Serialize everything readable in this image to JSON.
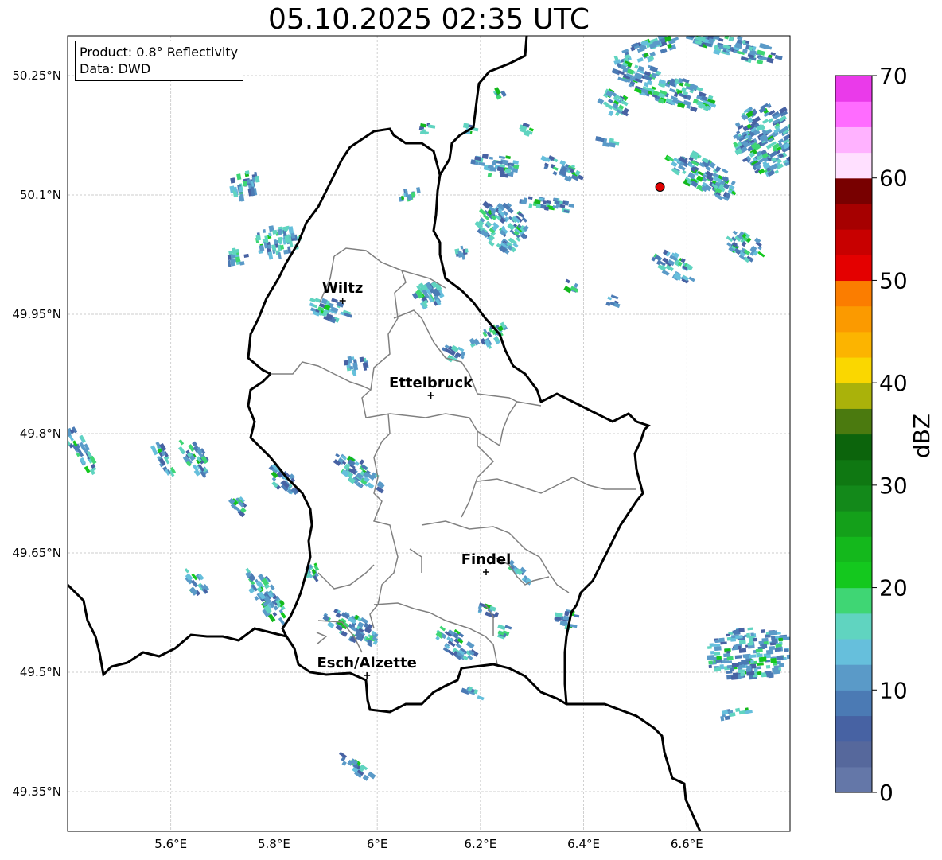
{
  "title": "05.10.2025 02:35 UTC",
  "info_box": {
    "product": "Product: 0.8° Reflectivity",
    "data": "Data: DWD"
  },
  "axes": {
    "lon_range": [
      5.4,
      6.8
    ],
    "lat_range": [
      49.3,
      50.3
    ],
    "x_ticks": [
      "5.6°E",
      "5.8°E",
      "6°E",
      "6.2°E",
      "6.4°E",
      "6.6°E"
    ],
    "y_ticks": [
      "50.25°N",
      "50.1°N",
      "49.95°N",
      "49.8°N",
      "49.65°N",
      "49.5°N",
      "49.35°N"
    ],
    "grid": true
  },
  "cities": [
    {
      "name": "Wiltz",
      "lon": 5.933,
      "lat": 49.967
    },
    {
      "name": "Ettelbruck",
      "lon": 6.104,
      "lat": 49.848
    },
    {
      "name": "Findel",
      "lon": 6.211,
      "lat": 49.626
    },
    {
      "name": "Esch/Alzette",
      "lon": 5.98,
      "lat": 49.496
    }
  ],
  "radar_site": {
    "lon": 6.548,
    "lat": 50.11,
    "color": "#e00000"
  },
  "colorbar": {
    "label": "dBZ",
    "min": 0,
    "max": 70,
    "step": 2.5,
    "ticks": [
      "0",
      "10",
      "20",
      "30",
      "40",
      "50",
      "60",
      "70"
    ],
    "colors": [
      "#6477a8",
      "#56689c",
      "#4762a3",
      "#4b7ab4",
      "#5a9ac8",
      "#66bfdc",
      "#60d4c0",
      "#3fd674",
      "#14c81e",
      "#14b81c",
      "#14a01a",
      "#13891a",
      "#0f7812",
      "#0c640c",
      "#4b7a0f",
      "#aab20a",
      "#fad700",
      "#fcb400",
      "#fb9a00",
      "#fb7d00",
      "#e40000",
      "#c80000",
      "#a60000",
      "#780000",
      "#ffe0ff",
      "#ffb2ff",
      "#ff6cff",
      "#ea3aea"
    ]
  }
}
